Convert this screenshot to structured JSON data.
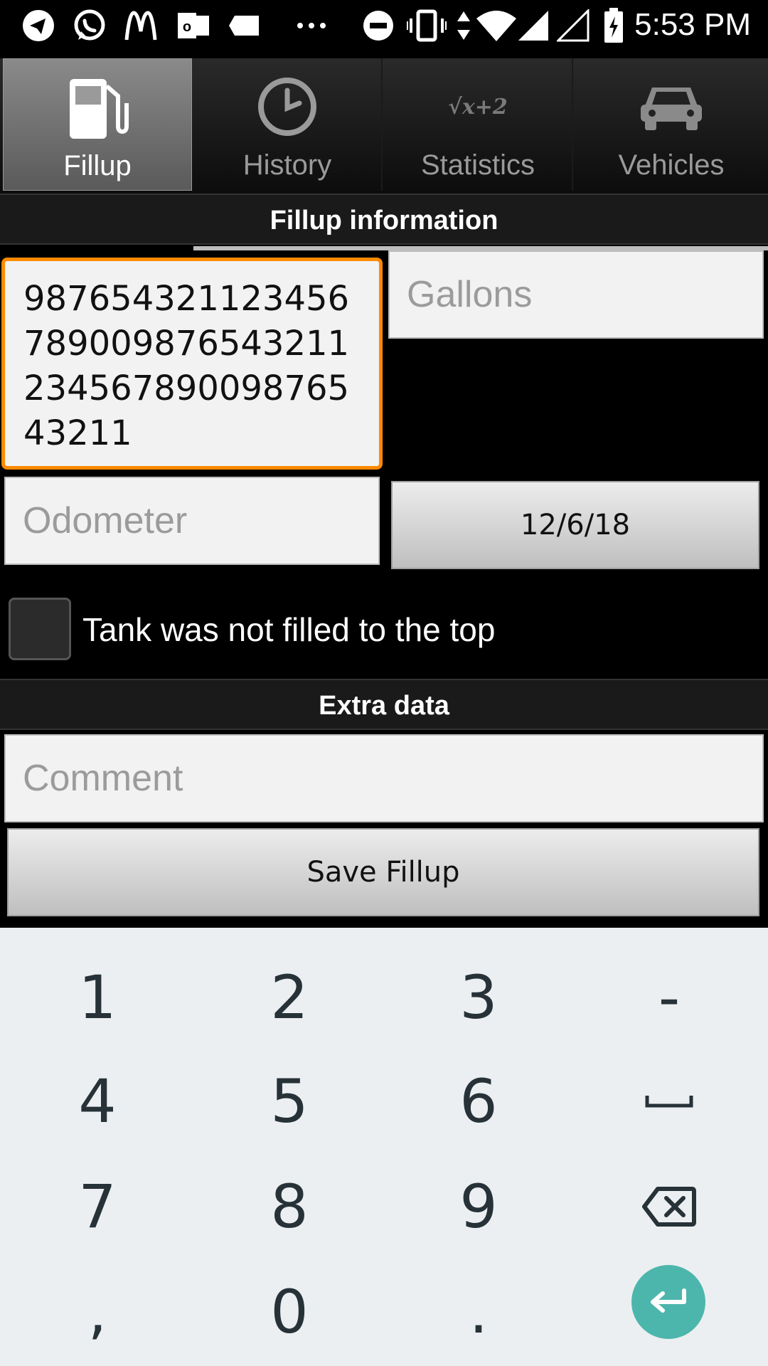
{
  "status_bar": {
    "time": "5:53 PM",
    "icons": [
      "telegram-icon",
      "whatsapp-icon",
      "mcdonalds-icon",
      "outlook-icon",
      "tag-icon",
      "more-dots-icon",
      "do-not-disturb-icon",
      "vibrate-icon",
      "data-arrows-icon",
      "wifi-icon",
      "signal-icon",
      "signal-empty-icon",
      "battery-charging-icon"
    ]
  },
  "tabs": [
    {
      "label": "Fillup",
      "icon": "fuel-pump-icon",
      "active": true
    },
    {
      "label": "History",
      "icon": "clock-icon",
      "active": false
    },
    {
      "label": "Statistics",
      "icon": "formula-icon",
      "active": false
    },
    {
      "label": "Vehicles",
      "icon": "car-icon",
      "active": false
    }
  ],
  "statistics_icon_text": "√x+2",
  "fillup_section": {
    "header": "Fillup information",
    "price_value": "9876543211234567890098765432112345678900987654321 1",
    "price_lines": [
      "987654321123456",
      "789009876543211",
      "234567890098765",
      "43211"
    ],
    "gallons_placeholder": "Gallons",
    "odometer_placeholder": "Odometer",
    "date_button": "12/6/18",
    "partial_fill_label": "Tank was not filled to the top",
    "partial_fill_checked": false
  },
  "extra_section": {
    "header": "Extra data",
    "comment_placeholder": "Comment",
    "save_button": "Save Fillup"
  },
  "keyboard": {
    "rows": [
      [
        "1",
        "2",
        "3",
        "-"
      ],
      [
        "4",
        "5",
        "6",
        "space"
      ],
      [
        "7",
        "8",
        "9",
        "backspace"
      ],
      [
        ",",
        "0",
        ".",
        "enter"
      ]
    ]
  },
  "colors": {
    "focus_border": "#ff8a00",
    "enter_key": "#4db6ac",
    "keyboard_bg": "#eceff1"
  }
}
